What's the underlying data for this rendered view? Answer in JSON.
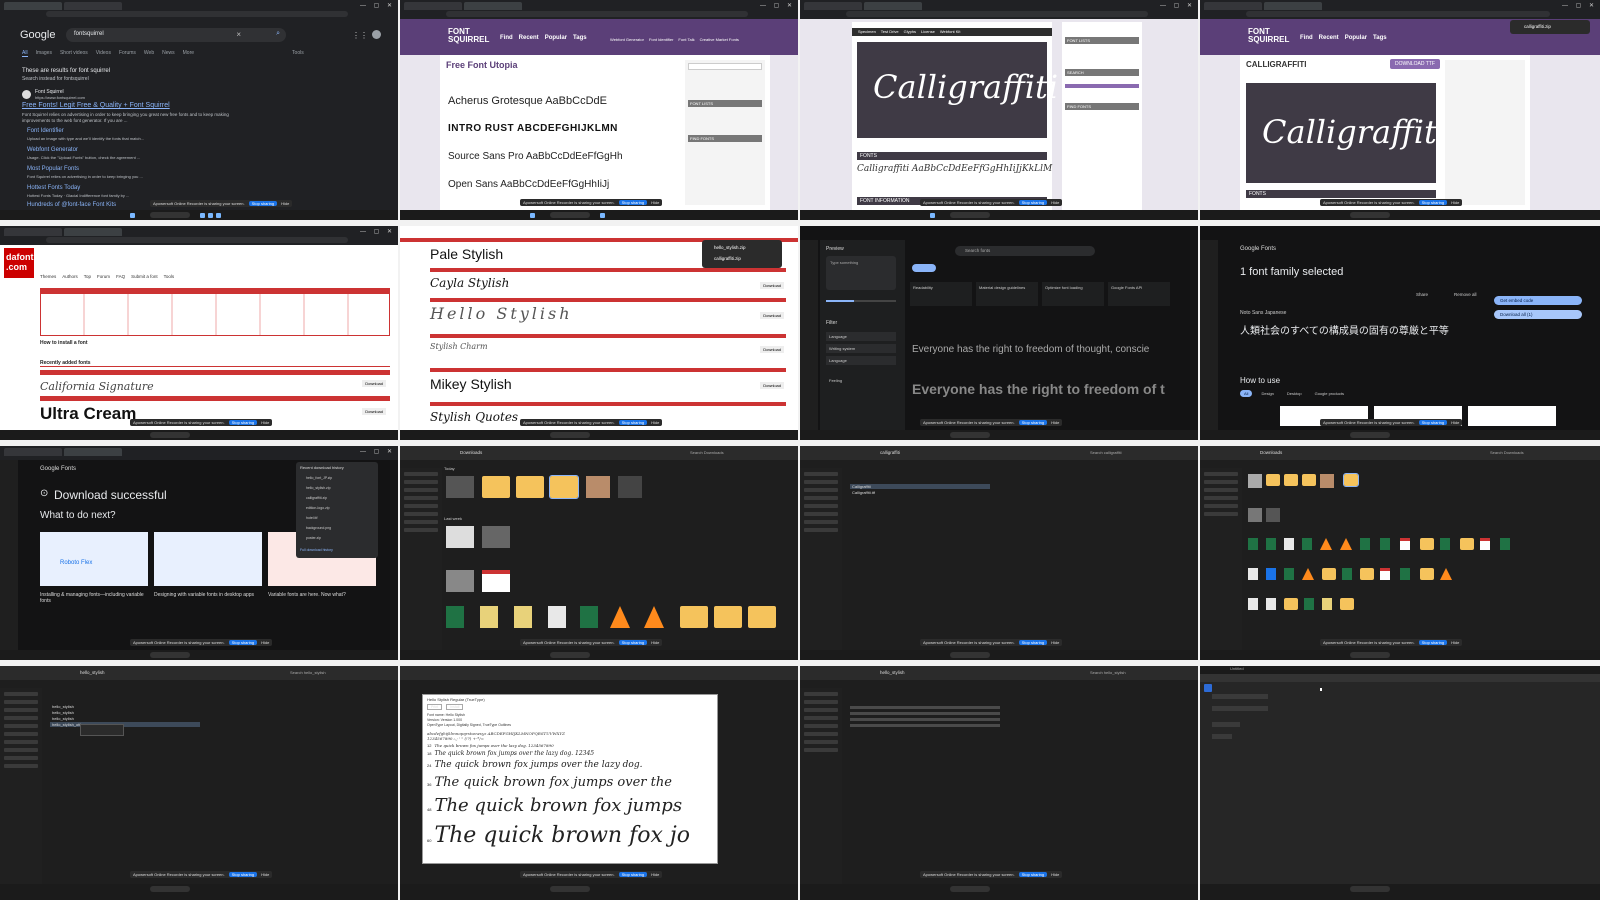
{
  "tiles": {
    "t1": {
      "search_query": "fontsquirrel",
      "logo": "Google",
      "tabs": [
        "All",
        "Images",
        "Short videos",
        "Videos",
        "Forums",
        "Web",
        "News",
        "More",
        "Tools"
      ],
      "notice": "These are results for font squirrel",
      "notice_sub": "Search instead for fontsquirrel",
      "site": "Font Squirrel",
      "site_url": "https://www.fontsquirrel.com",
      "result_title": "Free Fonts! Legit Free & Quality + Font Squirrel",
      "result_desc": "Font Squirrel relies on advertising in order to keep bringing you great new free fonts and to keep making improvements to the web font generator. If you are ...",
      "links": [
        {
          "title": "Font Identifier",
          "desc": "Upload an image with type and we'll identify the fonts that match..."
        },
        {
          "title": "Webfont Generator",
          "desc": "Usage. Click the \"Upload Fonts\" button, check the agreement ..."
        },
        {
          "title": "Most Popular Fonts",
          "desc": "Font Squirrel relies on advertising in order to keep bringing you ..."
        },
        {
          "title": "Hottest Fonts Today",
          "desc": "Hottest Fonts Today · Glacial Indifference font family by ..."
        },
        {
          "title": "Hundreds of @font-face Font Kits",
          "desc": ""
        }
      ]
    },
    "t2": {
      "logo": "FONT SQUIRREL",
      "nav": [
        "Find",
        "Recent",
        "Popular",
        "Tags"
      ],
      "nav_right": [
        "Webfont Generator",
        "Font Identifier",
        "Font Talk",
        "Creative Market Fonts"
      ],
      "heading": "Free Font Utopia",
      "fonts": [
        "Acherus Grotesque AaBbCcDdE",
        "INTRO RUST ABCDEFGHIJKLMN",
        "Source Sans Pro AaBbCcDdEeFfGgHh",
        "Open Sans AaBbCcDdEeFfGgHhIiJj"
      ],
      "sidebar_heads": [
        "FONT LISTS",
        "FIND FONTS"
      ]
    },
    "t3": {
      "tabs": [
        "Specimen",
        "Test Drive",
        "Glyphs",
        "License",
        "Webfont Kit"
      ],
      "preview": "Calligraffiti",
      "section_fonts": "FONTS",
      "sample": "Calligraffiti AaBbCcDdEeFfGgHhIiJjKkLlM",
      "section_info": "FONT INFORMATION",
      "sidebar_heads": [
        "FONT LISTS",
        "SEARCH",
        "FIND FONTS"
      ]
    },
    "t4": {
      "logo": "FONT SQUIRREL",
      "nav": [
        "Find",
        "Recent",
        "Popular",
        "Tags"
      ],
      "title": "CALLIGRAFFITI",
      "download_btn": "DOWNLOAD TTF",
      "preview": "Calligraffiti",
      "section_fonts": "FONTS",
      "popup": "calligraffiti.zip"
    },
    "t5": {
      "logo": "dafont .com",
      "nav": [
        "Themes",
        "Authors",
        "Top",
        "Forum",
        "FAQ",
        "Submit a font",
        "Tools"
      ],
      "how_to": "How to install a font",
      "recent": "Recently added fonts",
      "sample1": "California Signature",
      "sample2": "Ultra Cream",
      "download": "Download"
    },
    "t6": {
      "samples": [
        "Pale Stylish",
        "Cayla Stylish",
        "Hello Stylish",
        "Stylish Charm",
        "Mikey Stylish",
        "Stylish Quotes"
      ],
      "download": "Download",
      "popup_items": [
        "hello_stylish.zip",
        "calligraffiti.zip"
      ]
    },
    "t7": {
      "search": "Search fonts",
      "preview_label": "Preview",
      "type_something": "Type something",
      "filter_label": "Filter",
      "filters": [
        "Language",
        "Writing system",
        "Language",
        "Feeling"
      ],
      "cards": [
        "Readability",
        "Material design guidelines",
        "Optimize font loading",
        "Google Fonts API"
      ],
      "sample1": "Everyone has the right to freedom of thought, conscie",
      "sample2": "Everyone has the right to freedom of t"
    },
    "t8": {
      "logo": "Google Fonts",
      "selected": "1 font family selected",
      "share": "Share",
      "remove": "Remove all",
      "family": "Noto Sans Japanese",
      "jp": "人類社会のすべての構成員の固有の尊厳と平等",
      "get_code": "Get embed code",
      "download_all": "Download all (1)",
      "how": "How to use",
      "chips": [
        "All",
        "Design",
        "Desktop",
        "Google products"
      ]
    },
    "t9": {
      "logo": "Google Fonts",
      "heading": "Download successful",
      "question": "What to do next?",
      "cards": [
        {
          "title": "Installing & managing fonts—including variable fonts",
          "img": "Roboto Flex"
        },
        {
          "title": "Designing with variable fonts in desktop apps",
          "img": ""
        },
        {
          "title": "Variable fonts are here. Now what?",
          "img": ""
        }
      ],
      "history_title": "Recent download history",
      "history": [
        "hello_font_JP.zip",
        "hello_stylish.zip",
        "calligraffiti.zip",
        "edition-logo.zip",
        "hotel.ttf",
        "background.png",
        "poster.zip"
      ],
      "full_history": "Full download history"
    },
    "t10": {
      "path": "Downloads",
      "search": "Search Downloads",
      "section": "Today",
      "section2": "Last week"
    },
    "t11": {
      "path": "calligraffiti",
      "search": "Search calligraffiti",
      "files": [
        "Calligraffiti",
        "Calligraffiti.ttf"
      ]
    },
    "t12": {
      "path": "Downloads",
      "search": "Search Downloads"
    },
    "t13": {
      "path": "hello_stylish",
      "search": "Search hello_stylish",
      "files": [
        "hello_stylish",
        "hello_stylish",
        "hello_stylish",
        "hello_stylish_otf"
      ]
    },
    "t14": {
      "title": "Hello Stylish Regular (TrueType)",
      "buttons": [
        "Print",
        "Install"
      ],
      "meta": [
        "Font name: Hello Stylish",
        "Version: Version 1.000",
        "OpenType Layout, Digitally Signed, TrueType Outlines"
      ],
      "abc": "abcdefghijklmnopqrstuvwxyz ABCDEFGHIJKLMNOPQRSTUVWXYZ",
      "num": "1234567890.:,; ' \" (!?) +-*/=",
      "samples": [
        {
          "size": "12",
          "text": "The quick brown fox jumps over the lazy dog. 1234567890"
        },
        {
          "size": "18",
          "text": "The quick brown fox jumps over the lazy dog. 12345"
        },
        {
          "size": "24",
          "text": "The quick brown fox jumps over the lazy dog."
        },
        {
          "size": "36",
          "text": "The quick brown fox jumps over the"
        },
        {
          "size": "48",
          "text": "The quick brown fox jumps"
        },
        {
          "size": "60",
          "text": "The quick brown fox jo"
        }
      ]
    },
    "t15": {
      "path": "hello_stylish",
      "search": "Search hello_stylish"
    },
    "t16": {
      "title": "Untitled"
    }
  },
  "recording": {
    "notice": "Apowersoft Online Recorder is sharing your screen.",
    "stop": "Stop sharing",
    "hide": "Hide"
  }
}
